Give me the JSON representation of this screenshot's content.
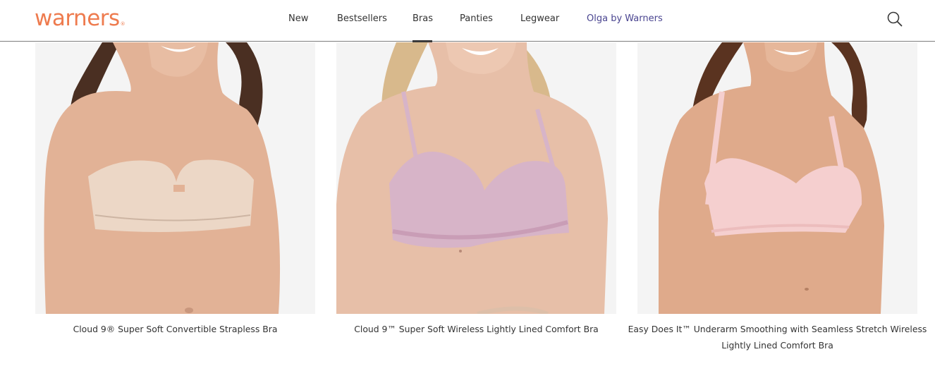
{
  "brand": {
    "logo_text": "warners",
    "logo_mark": "®",
    "logo_color": "#ee7b4e"
  },
  "nav": {
    "items": [
      {
        "label": "New"
      },
      {
        "label": "Bestsellers"
      },
      {
        "label": "Bras",
        "active": true
      },
      {
        "label": "Panties"
      },
      {
        "label": "Legwear"
      },
      {
        "label": "Olga by Warners",
        "accent": true
      }
    ],
    "accent_color": "#4a4590"
  },
  "search": {
    "icon": "search-icon"
  },
  "products": [
    {
      "name": "Cloud 9® Super Soft Convertible Strapless Bra",
      "bra_color": "#ecd7c6"
    },
    {
      "name": "Cloud 9™ Super Soft Wireless Lightly Lined Comfort Bra",
      "bra_color": "#d7b4c8"
    },
    {
      "name": "Easy Does It™ Underarm Smoothing with Seamless Stretch Wireless Lightly Lined Comfort Bra",
      "bra_color": "#f5cfcf"
    }
  ]
}
